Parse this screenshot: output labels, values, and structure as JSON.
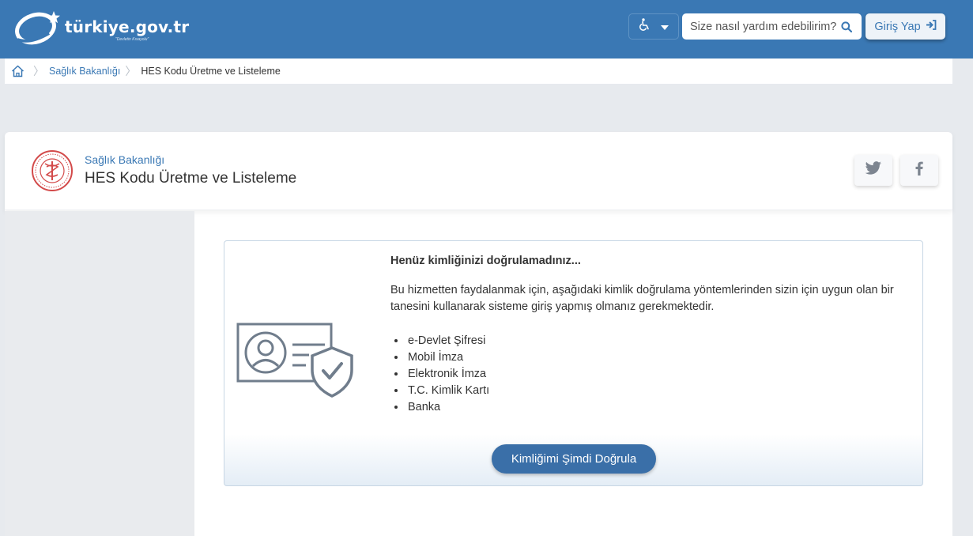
{
  "header": {
    "logo_text": "türkiye.gov.tr",
    "logo_tagline": "\"Devletin Kısayolu\"",
    "search_placeholder": "Size nasıl yardım edebilirim?",
    "login_label": "Giriş Yap",
    "accessibility_icon": "wheelchair-icon",
    "search_icon": "search-icon",
    "login_icon": "sign-in-icon"
  },
  "breadcrumb": {
    "items": [
      {
        "label": "Sağlık Bakanlığı"
      },
      {
        "label": "HES Kodu Üretme ve Listeleme"
      }
    ]
  },
  "page": {
    "institution": "Sağlık Bakanlığı",
    "title": "HES Kodu Üretme ve Listeleme",
    "share": [
      "twitter-icon",
      "facebook-icon"
    ]
  },
  "notice": {
    "title": "Henüz kimliğinizi doğrulamadınız...",
    "body": "Bu hizmetten faydalanmak için, aşağıdaki kimlik doğrulama yöntemlerinden sizin için uygun olan bir tanesini kullanarak sisteme giriş yapmış olmanız gerekmektedir.",
    "methods": [
      "e-Devlet Şifresi",
      "Mobil İmza",
      "Elektronik İmza",
      "T.C. Kimlik Kartı",
      "Banka"
    ],
    "button_label": "Kimliğimi Şimdi Doğrula"
  },
  "colors": {
    "brand_blue": "#3a78b4",
    "button_blue": "#3a6fa8",
    "page_bg": "#e7eaee"
  }
}
